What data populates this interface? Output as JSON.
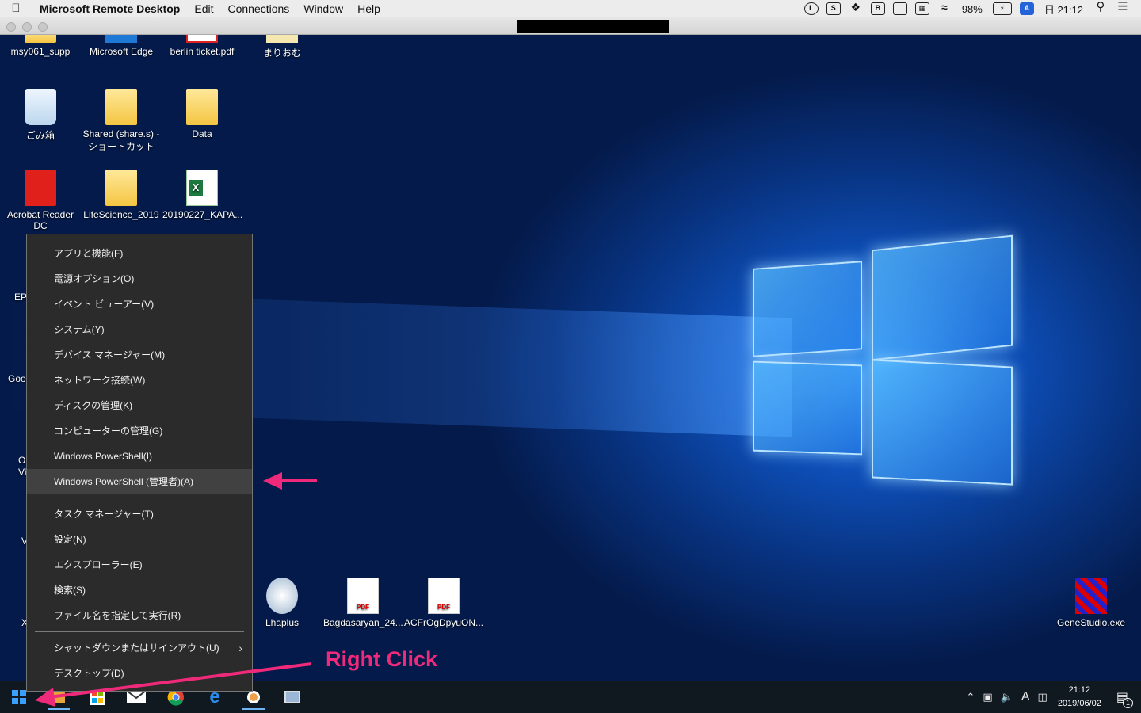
{
  "mac_menubar": {
    "app_name": "Microsoft Remote Desktop",
    "menus": [
      "Edit",
      "Connections",
      "Window",
      "Help"
    ],
    "battery": "98%",
    "input_indicator": "A",
    "clock": "日 21:12"
  },
  "desktop_icons": [
    {
      "label": "msy061_supp"
    },
    {
      "label": "Microsoft Edge"
    },
    {
      "label": "berlin ticket.pdf"
    },
    {
      "label": "まりおむ"
    },
    {
      "label": "ごみ箱"
    },
    {
      "label": "Shared (share.s) - ショートカット"
    },
    {
      "label": "Data"
    },
    {
      "label": "Acrobat Reader DC"
    },
    {
      "label": "LifeScience_2019"
    },
    {
      "label": "20190227_KAPA..."
    },
    {
      "label": "Lhaplus"
    },
    {
      "label": "Bagdasaryan_24..."
    },
    {
      "label": "ACFrOgDpyuON..."
    },
    {
      "label": "GeneStudio.exe"
    }
  ],
  "partial_icons": [
    "EPS",
    "Goo",
    "O",
    "Vi",
    "V",
    "X"
  ],
  "context_menu": {
    "items": [
      "アプリと機能(F)",
      "電源オプション(O)",
      "イベント ビューアー(V)",
      "システム(Y)",
      "デバイス マネージャー(M)",
      "ネットワーク接続(W)",
      "ディスクの管理(K)",
      "コンピューターの管理(G)",
      "Windows PowerShell(I)",
      "Windows PowerShell (管理者)(A)",
      "タスク マネージャー(T)",
      "設定(N)",
      "エクスプローラー(E)",
      "検索(S)",
      "ファイル名を指定して実行(R)",
      "シャットダウンまたはサインアウト(U)",
      "デスクトップ(D)"
    ],
    "highlighted": "Windows PowerShell (管理者)(A)"
  },
  "annotation": {
    "label": "Right Click",
    "color": "#ef2a7a"
  },
  "taskbar": {
    "apps": [
      "start",
      "store",
      "windows-store",
      "mail",
      "chrome",
      "edge",
      "app-orange",
      "remote-desktop"
    ],
    "tray_ime": "A",
    "time": "21:12",
    "date": "2019/06/02",
    "notification_count": "1"
  }
}
